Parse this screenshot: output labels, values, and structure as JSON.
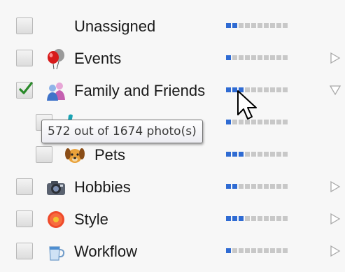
{
  "tags": [
    {
      "label": "Unassigned",
      "checked": false,
      "icon": "none",
      "meter_level": 0.2,
      "expander": "none"
    },
    {
      "label": "Events",
      "checked": false,
      "icon": "balloons-icon",
      "meter_level": 0.1,
      "expander": "collapsed"
    },
    {
      "label": "Family and Friends",
      "checked": true,
      "icon": "people-icon",
      "meter_level": 0.3,
      "expander": "expanded"
    },
    {
      "label": "",
      "checked": false,
      "icon": "partial-icon",
      "meter_level": 0.1,
      "expander": "none"
    },
    {
      "label": "Pets",
      "checked": false,
      "icon": "dog-icon",
      "meter_level": 0.3,
      "expander": "none"
    },
    {
      "label": "Hobbies",
      "checked": false,
      "icon": "camera-icon",
      "meter_level": 0.2,
      "expander": "collapsed"
    },
    {
      "label": "Style",
      "checked": false,
      "icon": "flower-icon",
      "meter_level": 0.3,
      "expander": "collapsed"
    },
    {
      "label": "Workflow",
      "checked": false,
      "icon": "mug-icon",
      "meter_level": 0.1,
      "expander": "collapsed"
    }
  ],
  "tooltip": {
    "text": "572 out of 1674 photo(s)"
  },
  "colors": {
    "meter_on": "#2f6bd3",
    "meter_off": "#c8c8c8",
    "check": "#2a8a2a"
  }
}
